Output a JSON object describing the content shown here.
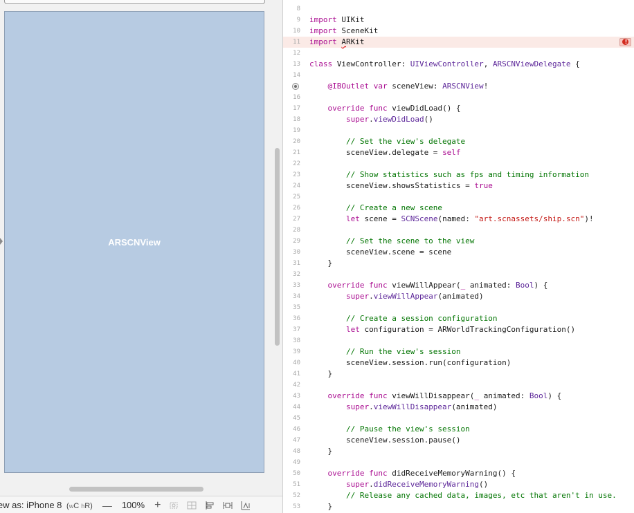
{
  "ib_canvas": {
    "view_label": "ARSCNView"
  },
  "bottom_bar": {
    "view_as": "iew as: iPhone 8",
    "size_class_open": "(",
    "size_class_w": "w",
    "size_class_c": "C ",
    "size_class_h": "h",
    "size_class_r": "R)",
    "zoom_minus": "—",
    "zoom_level": "100%",
    "zoom_plus": "+"
  },
  "editor": {
    "error_line": "11",
    "lines": [
      {
        "num": "8",
        "tokens": []
      },
      {
        "num": "9",
        "tokens": [
          {
            "t": "import ",
            "c": "keyword"
          },
          {
            "t": "UIKit",
            "c": "plain"
          }
        ]
      },
      {
        "num": "10",
        "tokens": [
          {
            "t": "import ",
            "c": "keyword"
          },
          {
            "t": "SceneKit",
            "c": "plain"
          }
        ]
      },
      {
        "num": "11",
        "tokens": [
          {
            "t": "import ",
            "c": "keyword"
          },
          {
            "t": "A",
            "c": "err"
          },
          {
            "t": "RKit",
            "c": "plain"
          }
        ]
      },
      {
        "num": "12",
        "tokens": []
      },
      {
        "num": "13",
        "tokens": [
          {
            "t": "class ",
            "c": "keyword"
          },
          {
            "t": "ViewController: ",
            "c": "plain"
          },
          {
            "t": "UIViewController",
            "c": "type"
          },
          {
            "t": ", ",
            "c": "plain"
          },
          {
            "t": "ARSCNViewDelegate",
            "c": "type"
          },
          {
            "t": " {",
            "c": "plain"
          }
        ]
      },
      {
        "num": "14",
        "tokens": []
      },
      {
        "num": "15",
        "tokens": [
          {
            "t": "    @IBOutlet ",
            "c": "keyword"
          },
          {
            "t": "var ",
            "c": "keyword"
          },
          {
            "t": "sceneView: ",
            "c": "plain"
          },
          {
            "t": "ARSCNView",
            "c": "type"
          },
          {
            "t": "!",
            "c": "plain"
          }
        ]
      },
      {
        "num": "16",
        "tokens": []
      },
      {
        "num": "17",
        "tokens": [
          {
            "t": "    override ",
            "c": "keyword"
          },
          {
            "t": "func ",
            "c": "keyword"
          },
          {
            "t": "viewDidLoad() {",
            "c": "plain"
          }
        ]
      },
      {
        "num": "18",
        "tokens": [
          {
            "t": "        super",
            "c": "keyword"
          },
          {
            "t": ".",
            "c": "plain"
          },
          {
            "t": "viewDidLoad",
            "c": "type"
          },
          {
            "t": "()",
            "c": "plain"
          }
        ]
      },
      {
        "num": "19",
        "tokens": []
      },
      {
        "num": "20",
        "tokens": [
          {
            "t": "        // Set the view's delegate",
            "c": "comment"
          }
        ]
      },
      {
        "num": "21",
        "tokens": [
          {
            "t": "        sceneView.delegate = ",
            "c": "plain"
          },
          {
            "t": "self",
            "c": "keyword"
          }
        ]
      },
      {
        "num": "22",
        "tokens": []
      },
      {
        "num": "23",
        "tokens": [
          {
            "t": "        // Show statistics such as fps and timing information",
            "c": "comment"
          }
        ]
      },
      {
        "num": "24",
        "tokens": [
          {
            "t": "        sceneView.showsStatistics = ",
            "c": "plain"
          },
          {
            "t": "true",
            "c": "keyword"
          }
        ]
      },
      {
        "num": "25",
        "tokens": []
      },
      {
        "num": "26",
        "tokens": [
          {
            "t": "        // Create a new scene",
            "c": "comment"
          }
        ]
      },
      {
        "num": "27",
        "tokens": [
          {
            "t": "        let ",
            "c": "keyword"
          },
          {
            "t": "scene = ",
            "c": "plain"
          },
          {
            "t": "SCNScene",
            "c": "type"
          },
          {
            "t": "(named: ",
            "c": "plain"
          },
          {
            "t": "\"art.scnassets/ship.scn\"",
            "c": "string"
          },
          {
            "t": ")!",
            "c": "plain"
          }
        ]
      },
      {
        "num": "28",
        "tokens": []
      },
      {
        "num": "29",
        "tokens": [
          {
            "t": "        // Set the scene to the view",
            "c": "comment"
          }
        ]
      },
      {
        "num": "30",
        "tokens": [
          {
            "t": "        sceneView.scene = scene",
            "c": "plain"
          }
        ]
      },
      {
        "num": "31",
        "tokens": [
          {
            "t": "    }",
            "c": "plain"
          }
        ]
      },
      {
        "num": "32",
        "tokens": []
      },
      {
        "num": "33",
        "tokens": [
          {
            "t": "    override ",
            "c": "keyword"
          },
          {
            "t": "func ",
            "c": "keyword"
          },
          {
            "t": "viewWillAppear(",
            "c": "plain"
          },
          {
            "t": "_ ",
            "c": "keyword"
          },
          {
            "t": "animated: ",
            "c": "plain"
          },
          {
            "t": "Bool",
            "c": "type"
          },
          {
            "t": ") {",
            "c": "plain"
          }
        ]
      },
      {
        "num": "34",
        "tokens": [
          {
            "t": "        super",
            "c": "keyword"
          },
          {
            "t": ".",
            "c": "plain"
          },
          {
            "t": "viewWillAppear",
            "c": "type"
          },
          {
            "t": "(animated)",
            "c": "plain"
          }
        ]
      },
      {
        "num": "35",
        "tokens": []
      },
      {
        "num": "36",
        "tokens": [
          {
            "t": "        // Create a session configuration",
            "c": "comment"
          }
        ]
      },
      {
        "num": "37",
        "tokens": [
          {
            "t": "        let ",
            "c": "keyword"
          },
          {
            "t": "configuration = ARWorldTrackingConfiguration()",
            "c": "plain"
          }
        ]
      },
      {
        "num": "38",
        "tokens": []
      },
      {
        "num": "39",
        "tokens": [
          {
            "t": "        // Run the view's session",
            "c": "comment"
          }
        ]
      },
      {
        "num": "40",
        "tokens": [
          {
            "t": "        sceneView.session.run(configuration)",
            "c": "plain"
          }
        ]
      },
      {
        "num": "41",
        "tokens": [
          {
            "t": "    }",
            "c": "plain"
          }
        ]
      },
      {
        "num": "42",
        "tokens": []
      },
      {
        "num": "43",
        "tokens": [
          {
            "t": "    override ",
            "c": "keyword"
          },
          {
            "t": "func ",
            "c": "keyword"
          },
          {
            "t": "viewWillDisappear(",
            "c": "plain"
          },
          {
            "t": "_ ",
            "c": "keyword"
          },
          {
            "t": "animated: ",
            "c": "plain"
          },
          {
            "t": "Bool",
            "c": "type"
          },
          {
            "t": ") {",
            "c": "plain"
          }
        ]
      },
      {
        "num": "44",
        "tokens": [
          {
            "t": "        super",
            "c": "keyword"
          },
          {
            "t": ".",
            "c": "plain"
          },
          {
            "t": "viewWillDisappear",
            "c": "type"
          },
          {
            "t": "(animated)",
            "c": "plain"
          }
        ]
      },
      {
        "num": "45",
        "tokens": []
      },
      {
        "num": "46",
        "tokens": [
          {
            "t": "        // Pause the view's session",
            "c": "comment"
          }
        ]
      },
      {
        "num": "47",
        "tokens": [
          {
            "t": "        sceneView.session.pause()",
            "c": "plain"
          }
        ]
      },
      {
        "num": "48",
        "tokens": [
          {
            "t": "    }",
            "c": "plain"
          }
        ]
      },
      {
        "num": "49",
        "tokens": []
      },
      {
        "num": "50",
        "tokens": [
          {
            "t": "    override ",
            "c": "keyword"
          },
          {
            "t": "func ",
            "c": "keyword"
          },
          {
            "t": "didReceiveMemoryWarning() {",
            "c": "plain"
          }
        ]
      },
      {
        "num": "51",
        "tokens": [
          {
            "t": "        super",
            "c": "keyword"
          },
          {
            "t": ".",
            "c": "plain"
          },
          {
            "t": "didReceiveMemoryWarning",
            "c": "type"
          },
          {
            "t": "()",
            "c": "plain"
          }
        ]
      },
      {
        "num": "52",
        "tokens": [
          {
            "t": "        // Release any cached data, images, etc that aren't in use.",
            "c": "comment"
          }
        ]
      },
      {
        "num": "53",
        "tokens": [
          {
            "t": "    }",
            "c": "plain"
          }
        ]
      }
    ]
  }
}
